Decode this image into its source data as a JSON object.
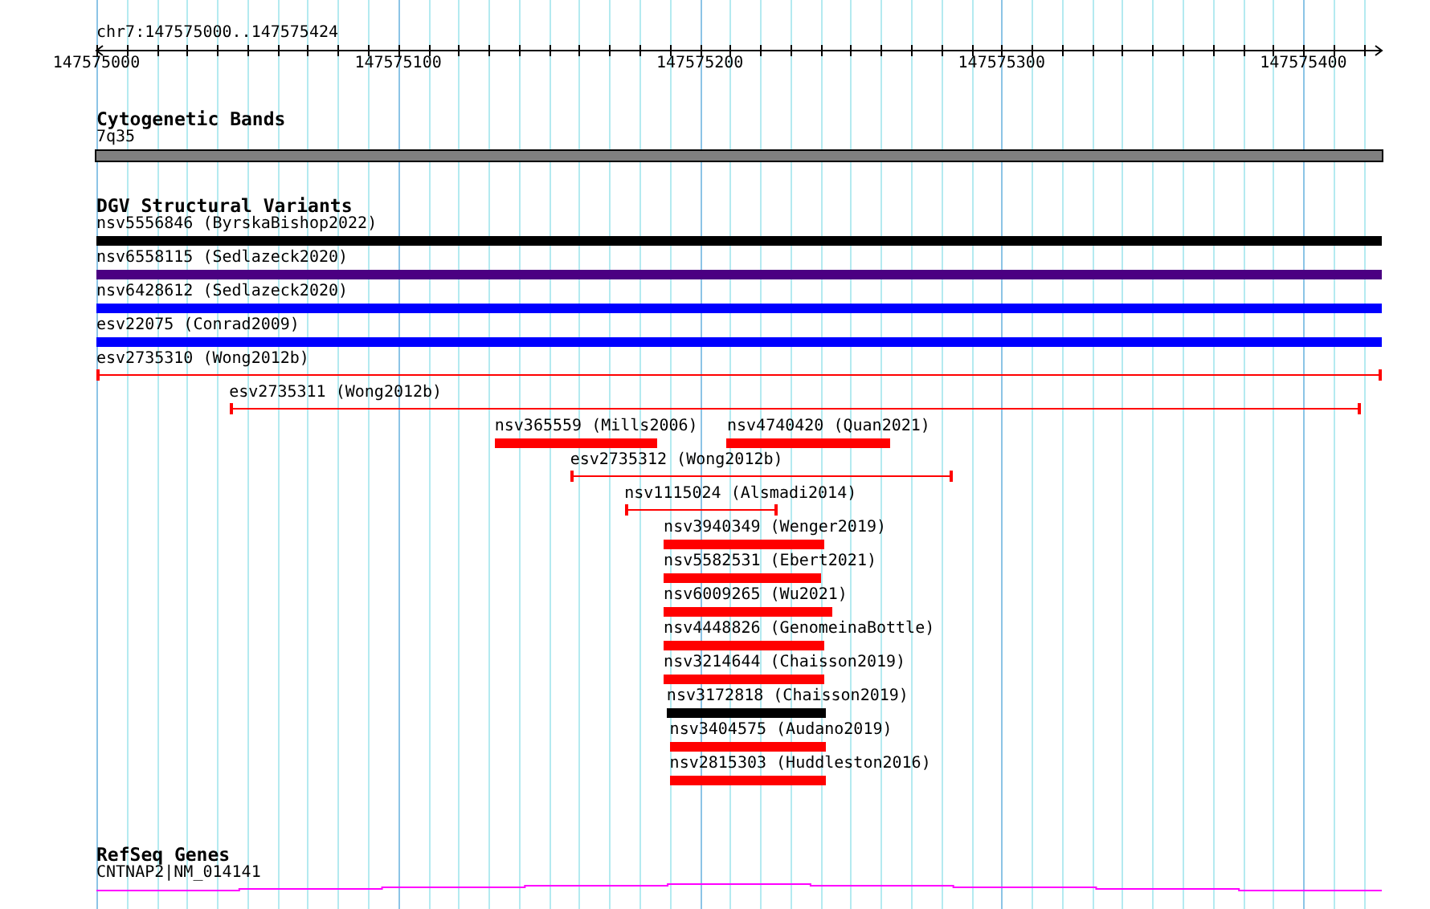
{
  "ruler": {
    "location": "chr7:147575000..147575424",
    "ticks": [
      "147575000",
      "147575100",
      "147575200",
      "147575300",
      "147575400"
    ]
  },
  "tracks": [
    {
      "kind": "bands",
      "title": "Cytogenetic Bands",
      "rows": [
        {
          "features": [
            {
              "kind": "band",
              "label": "7q35",
              "color": "#808080"
            }
          ]
        }
      ]
    },
    {
      "kind": "variants",
      "title": "DGV Structural Variants",
      "rows": [
        {
          "features": [
            {
              "kind": "bar",
              "label": "nsv5556846 (ByrskaBishop2022)",
              "color": "#000000"
            }
          ]
        },
        {
          "features": [
            {
              "kind": "bar",
              "label": "nsv6558115 (Sedlazeck2020)",
              "color": "#4b0082"
            }
          ]
        },
        {
          "features": [
            {
              "kind": "bar",
              "label": "nsv6428612 (Sedlazeck2020)",
              "color": "#0000ff"
            }
          ]
        },
        {
          "features": [
            {
              "kind": "bar",
              "label": "esv22075 (Conrad2009)",
              "color": "#0000ff"
            }
          ]
        },
        {
          "features": [
            {
              "kind": "span",
              "label": "esv2735310 (Wong2012b)",
              "color": "#ff0000"
            }
          ]
        },
        {
          "features": [
            {
              "kind": "span",
              "label": "esv2735311 (Wong2012b)",
              "color": "#ff0000"
            }
          ]
        },
        {
          "features": [
            {
              "kind": "bar",
              "label": "nsv365559 (Mills2006)",
              "color": "#ff0000"
            },
            {
              "kind": "bar",
              "label": "nsv4740420 (Quan2021)",
              "color": "#ff0000"
            }
          ]
        },
        {
          "features": [
            {
              "kind": "span",
              "label": "esv2735312 (Wong2012b)",
              "color": "#ff0000"
            }
          ]
        },
        {
          "features": [
            {
              "kind": "span",
              "label": "nsv1115024 (Alsmadi2014)",
              "color": "#ff0000"
            }
          ]
        },
        {
          "features": [
            {
              "kind": "bar",
              "label": "nsv3940349 (Wenger2019)",
              "color": "#ff0000"
            }
          ]
        },
        {
          "features": [
            {
              "kind": "bar",
              "label": "nsv5582531 (Ebert2021)",
              "color": "#ff0000"
            }
          ]
        },
        {
          "features": [
            {
              "kind": "bar",
              "label": "nsv6009265 (Wu2021)",
              "color": "#ff0000"
            }
          ]
        },
        {
          "features": [
            {
              "kind": "bar",
              "label": "nsv4448826 (GenomeinaBottle)",
              "color": "#ff0000"
            }
          ]
        },
        {
          "features": [
            {
              "kind": "bar",
              "label": "nsv3214644 (Chaisson2019)",
              "color": "#ff0000"
            }
          ]
        },
        {
          "features": [
            {
              "kind": "bar",
              "label": "nsv3172818 (Chaisson2019)",
              "color": "#000000"
            }
          ]
        },
        {
          "features": [
            {
              "kind": "bar",
              "label": "nsv3404575 (Audano2019)",
              "color": "#ff0000"
            }
          ]
        },
        {
          "features": [
            {
              "kind": "bar",
              "label": "nsv2815303 (Huddleston2016)",
              "color": "#ff0000"
            }
          ]
        }
      ]
    },
    {
      "kind": "genes",
      "title": "RefSeq Genes",
      "rows": [
        {
          "features": [
            {
              "kind": "gene",
              "label": "CNTNAP2|NM_014141",
              "color": "#ff00ff"
            }
          ]
        }
      ]
    }
  ]
}
